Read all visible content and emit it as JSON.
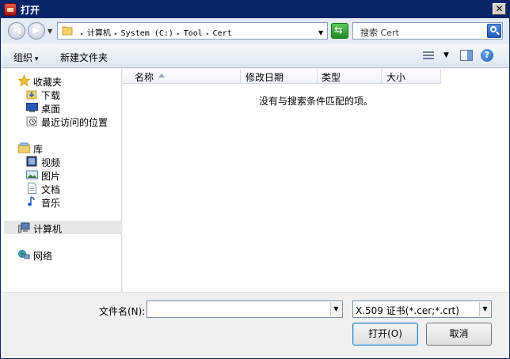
{
  "window": {
    "title": "打开"
  },
  "address": {
    "crumbs": [
      "计算机",
      "System (C:)",
      "Tool",
      "Cert"
    ],
    "search_placeholder": "搜索 Cert"
  },
  "toolbar": {
    "organize_label": "组织",
    "new_folder_label": "新建文件夹"
  },
  "nav": {
    "items": [
      {
        "label": "收藏夹",
        "icon": "star-icon"
      },
      {
        "label": "下载",
        "icon": "download-folder-icon"
      },
      {
        "label": "桌面",
        "icon": "desktop-icon"
      },
      {
        "label": "最近访问的位置",
        "icon": "recent-places-icon"
      },
      {
        "label": "库",
        "icon": "library-icon"
      },
      {
        "label": "视频",
        "icon": "video-icon"
      },
      {
        "label": "图片",
        "icon": "pictures-icon"
      },
      {
        "label": "文档",
        "icon": "documents-icon"
      },
      {
        "label": "音乐",
        "icon": "music-icon"
      },
      {
        "label": "计算机",
        "icon": "computer-icon",
        "selected": true
      },
      {
        "label": "网络",
        "icon": "network-icon"
      }
    ]
  },
  "files": {
    "columns": [
      "名称",
      "修改日期",
      "类型",
      "大小"
    ],
    "empty_message": "没有与搜索条件匹配的项。"
  },
  "footer": {
    "filename_label": "文件名(N):",
    "filename_value": "",
    "filter_value": "X.509 证书(*.cer;*.crt)",
    "open_label": "打开(O)",
    "cancel_label": "取消"
  }
}
